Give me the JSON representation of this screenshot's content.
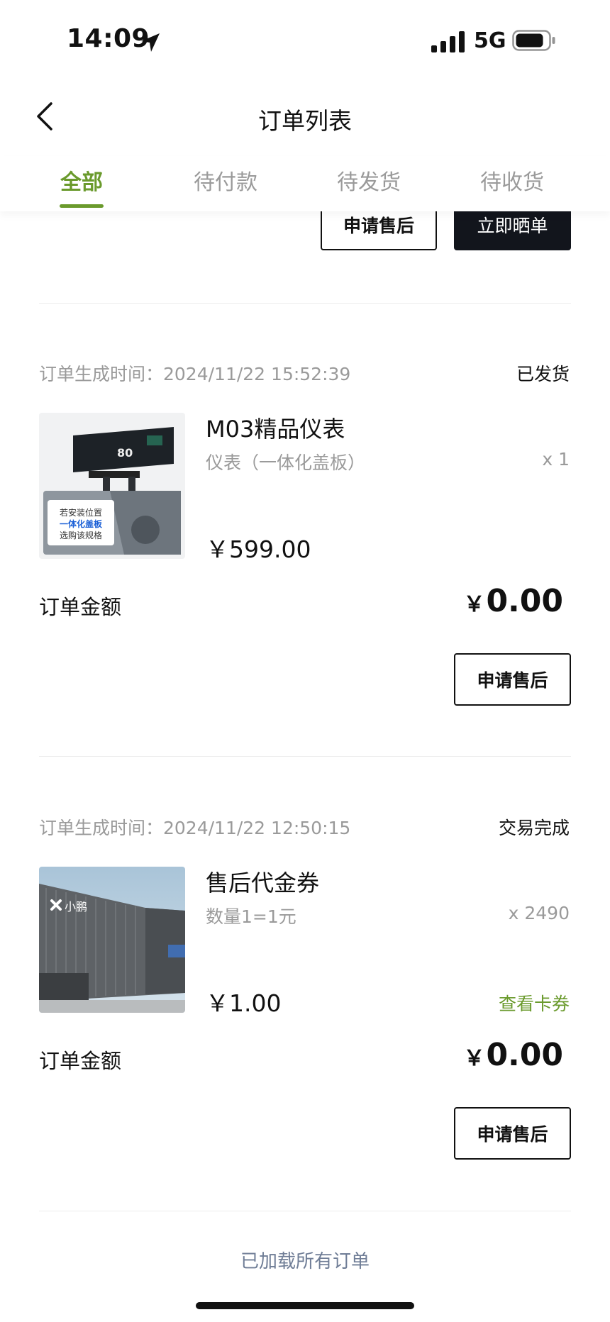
{
  "status_bar": {
    "time": "14:09",
    "network": "5G"
  },
  "nav": {
    "title": "订单列表"
  },
  "tabs": [
    {
      "label": "全部",
      "active": true
    },
    {
      "label": "待付款",
      "active": false
    },
    {
      "label": "待发货",
      "active": false
    },
    {
      "label": "待收货",
      "active": false
    }
  ],
  "top_partial_order": {
    "after_sale_label": "申请售后",
    "review_label": "立即晒单"
  },
  "orders": [
    {
      "time_label": "订单生成时间：2024/11/22 15:52:39",
      "status": "已发货",
      "product_name": "M03精品仪表",
      "product_spec": "仪表（一体化盖板）",
      "quantity": "x 1",
      "price": "￥599.00",
      "amount_label": "订单金额",
      "amount_currency": "￥",
      "amount_value": "0.00",
      "after_sale_label": "申请售后",
      "image_text": {
        "speed": "80",
        "line1": "若安装位置",
        "line2": "一体化盖板",
        "line3": "选购该规格"
      }
    },
    {
      "time_label": "订单生成时间：2024/11/22 12:50:15",
      "status": "交易完成",
      "product_name": "售后代金券",
      "product_spec": "数量1=1元",
      "quantity": "x 2490",
      "price": "￥1.00",
      "view_coupon_label": "查看卡券",
      "amount_label": "订单金额",
      "amount_currency": "￥",
      "amount_value": "0.00",
      "after_sale_label": "申请售后",
      "image_text": {
        "logo": "小鹏"
      }
    }
  ],
  "footer": {
    "note": "已加载所有订单"
  },
  "colors": {
    "accent_green": "#6a9a2c",
    "dark_button": "#12151c",
    "muted_text": "#9a9a9a",
    "footer_text": "#6f7d96"
  },
  "icons": [
    "location-arrow-icon",
    "signal-icon",
    "battery-icon",
    "back-chevron-icon"
  ]
}
